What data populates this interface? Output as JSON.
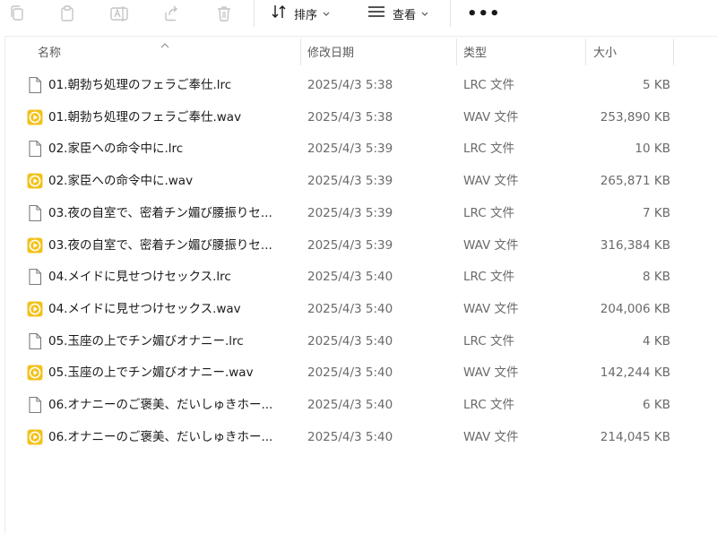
{
  "toolbar": {
    "sort_label": "排序",
    "view_label": "查看",
    "more_label": "•••",
    "icons": [
      "copy-icon",
      "paste-icon",
      "rename-icon",
      "share-icon",
      "delete-icon",
      "sort-icon",
      "view-icon",
      "more-icon"
    ]
  },
  "header": {
    "name": "名称",
    "date": "修改日期",
    "type": "类型",
    "size": "大小"
  },
  "files": [
    {
      "name": "01.朝勃ち処理のフェラご奉仕.lrc",
      "date": "2025/4/3 5:38",
      "type": "LRC 文件",
      "size": "5 KB",
      "kind": "lrc"
    },
    {
      "name": "01.朝勃ち処理のフェラご奉仕.wav",
      "date": "2025/4/3 5:38",
      "type": "WAV 文件",
      "size": "253,890 KB",
      "kind": "wav"
    },
    {
      "name": "02.家臣への命令中に.lrc",
      "date": "2025/4/3 5:39",
      "type": "LRC 文件",
      "size": "10 KB",
      "kind": "lrc"
    },
    {
      "name": "02.家臣への命令中に.wav",
      "date": "2025/4/3 5:39",
      "type": "WAV 文件",
      "size": "265,871 KB",
      "kind": "wav"
    },
    {
      "name": "03.夜の自室で、密着チン媚び腰振りセ...",
      "date": "2025/4/3 5:39",
      "type": "LRC 文件",
      "size": "7 KB",
      "kind": "lrc"
    },
    {
      "name": "03.夜の自室で、密着チン媚び腰振りセ...",
      "date": "2025/4/3 5:39",
      "type": "WAV 文件",
      "size": "316,384 KB",
      "kind": "wav"
    },
    {
      "name": "04.メイドに見せつけセックス.lrc",
      "date": "2025/4/3 5:40",
      "type": "LRC 文件",
      "size": "8 KB",
      "kind": "lrc"
    },
    {
      "name": "04.メイドに見せつけセックス.wav",
      "date": "2025/4/3 5:40",
      "type": "WAV 文件",
      "size": "204,006 KB",
      "kind": "wav"
    },
    {
      "name": "05.玉座の上でチン媚びオナニー.lrc",
      "date": "2025/4/3 5:40",
      "type": "LRC 文件",
      "size": "4 KB",
      "kind": "lrc"
    },
    {
      "name": "05.玉座の上でチン媚びオナニー.wav",
      "date": "2025/4/3 5:40",
      "type": "WAV 文件",
      "size": "142,244 KB",
      "kind": "wav"
    },
    {
      "name": "06.オナニーのご褒美、だいしゅきホー...",
      "date": "2025/4/3 5:40",
      "type": "LRC 文件",
      "size": "6 KB",
      "kind": "lrc"
    },
    {
      "name": "06.オナニーのご褒美、だいしゅきホー...",
      "date": "2025/4/3 5:40",
      "type": "WAV 文件",
      "size": "214,045 KB",
      "kind": "wav"
    }
  ],
  "colors": {
    "audio_icon": "#f2c21b",
    "toolbar_icon_disabled": "#c4c4c4"
  }
}
